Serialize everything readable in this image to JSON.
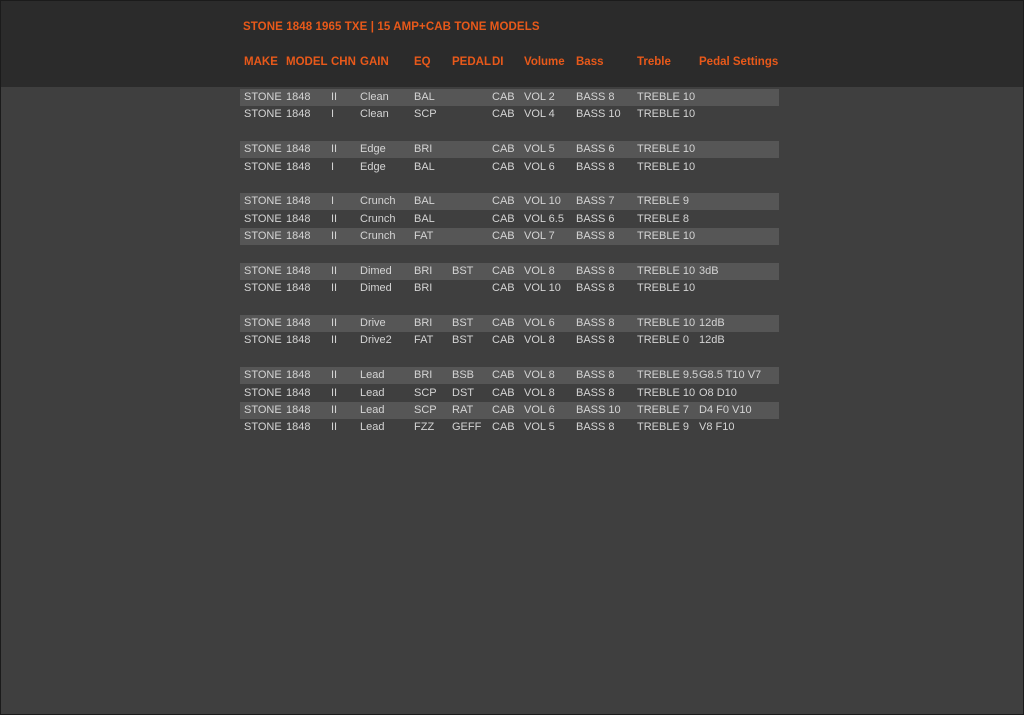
{
  "document": {
    "title": "STONE 1848 1965 TXE | 15 AMP+CAB TONE MODELS",
    "columns": [
      "MAKE",
      "MODEL",
      "CHN",
      "GAIN",
      "EQ",
      "PEDAL",
      "DI",
      "Volume",
      "Bass",
      "Treble",
      "Pedal Settings"
    ],
    "groups": [
      {
        "rows": [
          {
            "make": "STONE",
            "model": "1848",
            "chn": "II",
            "gain": "Clean",
            "eq": "BAL",
            "pedal": "",
            "di": "CAB",
            "volume": "VOL 2",
            "bass": "BASS 8",
            "treble": "TREBLE 10",
            "pedal_settings": ""
          },
          {
            "make": "STONE",
            "model": "1848",
            "chn": "I",
            "gain": "Clean",
            "eq": "SCP",
            "pedal": "",
            "di": "CAB",
            "volume": "VOL 4",
            "bass": "BASS 10",
            "treble": "TREBLE 10",
            "pedal_settings": ""
          }
        ]
      },
      {
        "rows": [
          {
            "make": "STONE",
            "model": "1848",
            "chn": "II",
            "gain": "Edge",
            "eq": "BRI",
            "pedal": "",
            "di": "CAB",
            "volume": "VOL 5",
            "bass": "BASS 6",
            "treble": "TREBLE 10",
            "pedal_settings": ""
          },
          {
            "make": "STONE",
            "model": "1848",
            "chn": "I",
            "gain": "Edge",
            "eq": "BAL",
            "pedal": "",
            "di": "CAB",
            "volume": "VOL 6",
            "bass": "BASS 8",
            "treble": "TREBLE 10",
            "pedal_settings": ""
          }
        ]
      },
      {
        "rows": [
          {
            "make": "STONE",
            "model": "1848",
            "chn": "I",
            "gain": "Crunch",
            "eq": "BAL",
            "pedal": "",
            "di": "CAB",
            "volume": "VOL 10",
            "bass": "BASS 7",
            "treble": "TREBLE 9",
            "pedal_settings": ""
          },
          {
            "make": "STONE",
            "model": "1848",
            "chn": "II",
            "gain": "Crunch",
            "eq": "BAL",
            "pedal": "",
            "di": "CAB",
            "volume": "VOL 6.5",
            "bass": "BASS 6",
            "treble": "TREBLE 8",
            "pedal_settings": ""
          },
          {
            "make": "STONE",
            "model": "1848",
            "chn": "II",
            "gain": "Crunch",
            "eq": "FAT",
            "pedal": "",
            "di": "CAB",
            "volume": "VOL 7",
            "bass": "BASS 8",
            "treble": "TREBLE 10",
            "pedal_settings": ""
          }
        ]
      },
      {
        "rows": [
          {
            "make": "STONE",
            "model": "1848",
            "chn": "II",
            "gain": "Dimed",
            "eq": "BRI",
            "pedal": "BST",
            "di": "CAB",
            "volume": "VOL 8",
            "bass": "BASS 8",
            "treble": "TREBLE 10",
            "pedal_settings": "3dB"
          },
          {
            "make": "STONE",
            "model": "1848",
            "chn": "II",
            "gain": "Dimed",
            "eq": "BRI",
            "pedal": "",
            "di": "CAB",
            "volume": "VOL 10",
            "bass": "BASS 8",
            "treble": "TREBLE 10",
            "pedal_settings": ""
          }
        ]
      },
      {
        "rows": [
          {
            "make": "STONE",
            "model": "1848",
            "chn": "II",
            "gain": "Drive",
            "eq": "BRI",
            "pedal": "BST",
            "di": "CAB",
            "volume": "VOL 6",
            "bass": "BASS 8",
            "treble": "TREBLE 10",
            "pedal_settings": "12dB"
          },
          {
            "make": "STONE",
            "model": "1848",
            "chn": "II",
            "gain": "Drive2",
            "eq": "FAT",
            "pedal": "BST",
            "di": "CAB",
            "volume": "VOL 8",
            "bass": "BASS 8",
            "treble": "TREBLE 0",
            "pedal_settings": "12dB"
          }
        ]
      },
      {
        "rows": [
          {
            "make": "STONE",
            "model": "1848",
            "chn": "II",
            "gain": "Lead",
            "eq": "BRI",
            "pedal": "BSB",
            "di": "CAB",
            "volume": "VOL 8",
            "bass": "BASS 8",
            "treble": "TREBLE 9.5",
            "pedal_settings": "G8.5 T10 V7"
          },
          {
            "make": "STONE",
            "model": "1848",
            "chn": "II",
            "gain": "Lead",
            "eq": "SCP",
            "pedal": "DST",
            "di": "CAB",
            "volume": "VOL 8",
            "bass": "BASS 8",
            "treble": "TREBLE 10",
            "pedal_settings": "O8 D10"
          },
          {
            "make": "STONE",
            "model": "1848",
            "chn": "II",
            "gain": "Lead",
            "eq": "SCP",
            "pedal": "RAT",
            "di": "CAB",
            "volume": "VOL 6",
            "bass": "BASS 10",
            "treble": "TREBLE 7",
            "pedal_settings": "D4 F0 V10"
          },
          {
            "make": "STONE",
            "model": "1848",
            "chn": "II",
            "gain": "Lead",
            "eq": "FZZ",
            "pedal": "GEFF",
            "di": "CAB",
            "volume": "VOL 5",
            "bass": "BASS 8",
            "treble": "TREBLE 9",
            "pedal_settings": "V8 F10"
          }
        ]
      }
    ],
    "colors": {
      "accent": "#e8591a",
      "header_bg": "#2b2b2b",
      "page_bg": "#3f3f3f",
      "row_band": "#565656",
      "text": "#d4d4d4"
    }
  }
}
